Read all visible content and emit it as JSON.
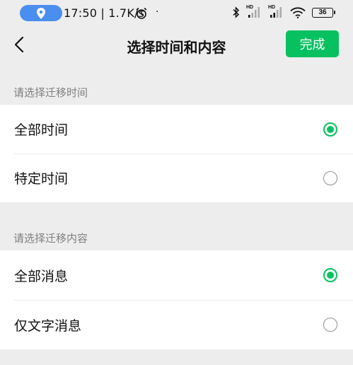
{
  "status_bar": {
    "time_speed": "17:50 | 1.7K/s",
    "dot": "·",
    "signal1_label": "HD",
    "signal2_label": "HD",
    "battery": "36"
  },
  "nav": {
    "title": "选择时间和内容",
    "done_label": "完成"
  },
  "sections": [
    {
      "label": "请选择迁移时间",
      "options": [
        {
          "label": "全部时间",
          "selected": true
        },
        {
          "label": "特定时间",
          "selected": false
        }
      ]
    },
    {
      "label": "请选择迁移内容",
      "options": [
        {
          "label": "全部消息",
          "selected": true
        },
        {
          "label": "仅文字消息",
          "selected": false
        }
      ]
    }
  ],
  "colors": {
    "accent": "#07c160",
    "location_pill": "#4a8ef0",
    "background": "#ededed"
  },
  "icons": [
    "location-pin-icon",
    "alarm-icon",
    "bluetooth-icon",
    "signal-icon",
    "wifi-icon",
    "battery-icon",
    "back-arrow-icon",
    "radio-icon"
  ]
}
